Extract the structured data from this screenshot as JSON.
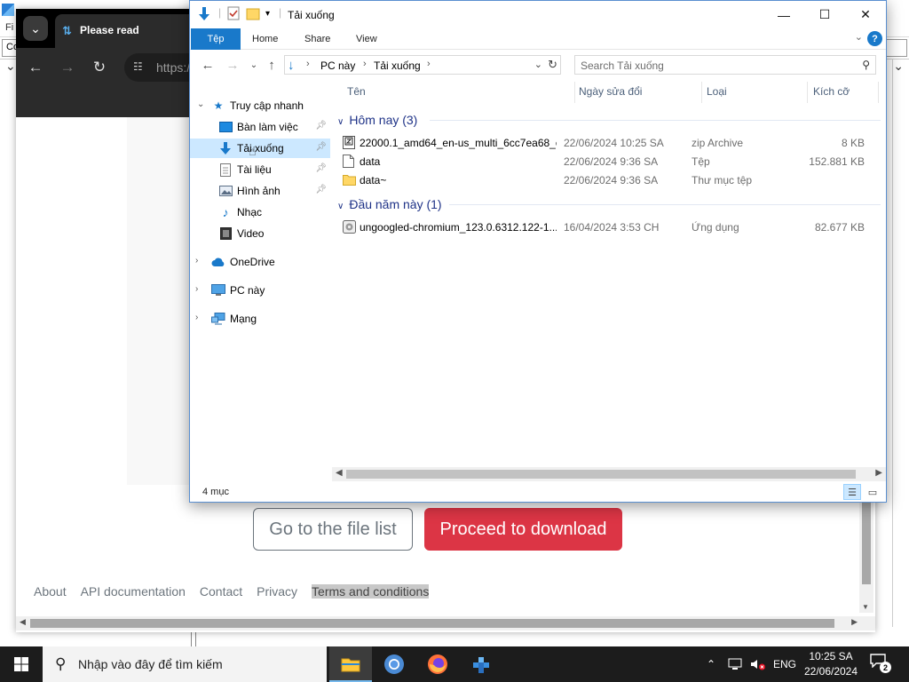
{
  "background_app": {
    "menu_text": "Fi",
    "addr_text": "Co"
  },
  "browser": {
    "tab_title": "Please read",
    "address_text": "https:/",
    "buttons": {
      "secondary": "Go to the file list",
      "primary": "Proceed to download"
    },
    "footer_links": [
      "About",
      "API documentation",
      "Contact",
      "Privacy",
      "Terms and conditions"
    ],
    "colors": {
      "primary": "#dc3545",
      "secondary": "#6c757d"
    }
  },
  "explorer": {
    "title": "Tải xuống",
    "ribbon_tabs": [
      "Tệp",
      "Home",
      "Share",
      "View"
    ],
    "address": {
      "root": "PC này",
      "current": "Tải xuống"
    },
    "search_placeholder": "Search Tải xuống",
    "nav_tree": [
      {
        "label": "Truy cập nhanh",
        "icon": "star-icon",
        "level": 0,
        "expanded": true
      },
      {
        "label": "Bàn làm việc",
        "icon": "desktop-icon",
        "level": 1,
        "pinned": true
      },
      {
        "label": "Tải xuống",
        "icon": "download-icon",
        "level": 1,
        "pinned": true,
        "selected": true
      },
      {
        "label": "Tài liệu",
        "icon": "document-icon",
        "level": 1,
        "pinned": true
      },
      {
        "label": "Hình ảnh",
        "icon": "pictures-icon",
        "level": 1,
        "pinned": true
      },
      {
        "label": "Nhạc",
        "icon": "music-icon",
        "level": 1
      },
      {
        "label": "Video",
        "icon": "video-icon",
        "level": 1
      },
      {
        "label": "OneDrive",
        "icon": "cloud-icon",
        "level": 0
      },
      {
        "label": "PC này",
        "icon": "computer-icon",
        "level": 0
      },
      {
        "label": "Mạng",
        "icon": "network-icon",
        "level": 0
      }
    ],
    "columns": {
      "name": "Tên",
      "date": "Ngày sửa đổi",
      "type": "Loại",
      "size": "Kích cỡ"
    },
    "groups": [
      {
        "header": "Hôm nay (3)",
        "items": [
          {
            "name": "22000.1_amd64_en-us_multi_6cc7ea68_c...",
            "date": "22/06/2024 10:25 SA",
            "type": "zip Archive",
            "size": "8 KB",
            "icon": "zip-icon"
          },
          {
            "name": "data",
            "date": "22/06/2024 9:36 SA",
            "type": "Tệp",
            "size": "152.881 KB",
            "icon": "file-icon"
          },
          {
            "name": "data~",
            "date": "22/06/2024 9:36 SA",
            "type": "Thư mục tệp",
            "size": "",
            "icon": "folder-icon"
          }
        ]
      },
      {
        "header": "Đầu năm này (1)",
        "items": [
          {
            "name": "ungoogled-chromium_123.0.6312.122-1....",
            "date": "16/04/2024 3:53 CH",
            "type": "Ứng dụng",
            "size": "82.677 KB",
            "icon": "installer-icon"
          }
        ]
      }
    ],
    "status": "4 mục"
  },
  "taskbar": {
    "search_placeholder": "Nhập vào đây để tìm kiếm",
    "language": "ENG",
    "time": "10:25 SA",
    "date": "22/06/2024",
    "notification_count": "2"
  }
}
